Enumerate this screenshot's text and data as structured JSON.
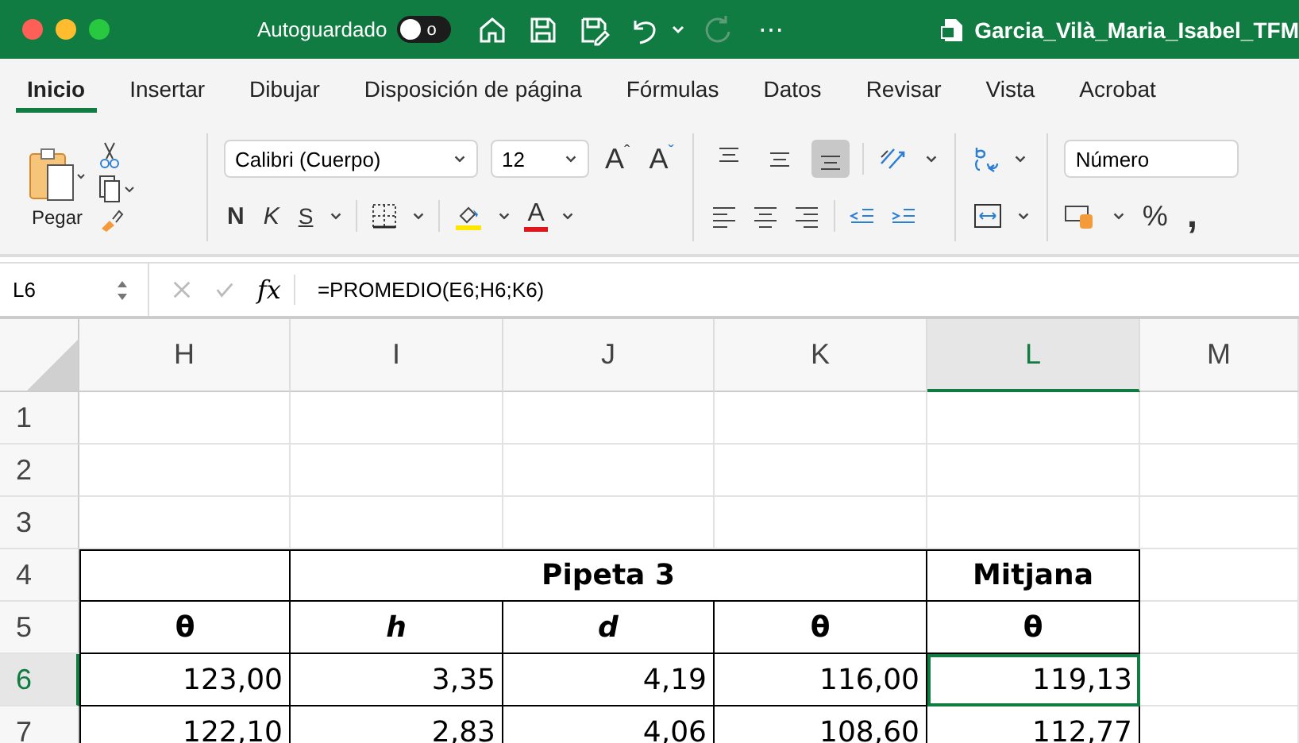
{
  "window": {
    "autosave_label": "Autoguardado",
    "autosave_on": false,
    "autosave_toggle_text": "o",
    "more": "⋯",
    "file_name": "Garcia_Vilà_Maria_Isabel_TFM"
  },
  "tabs": [
    {
      "label": "Inicio",
      "selected": true
    },
    {
      "label": "Insertar",
      "selected": false
    },
    {
      "label": "Dibujar",
      "selected": false
    },
    {
      "label": "Disposición de página",
      "selected": false
    },
    {
      "label": "Fórmulas",
      "selected": false
    },
    {
      "label": "Datos",
      "selected": false
    },
    {
      "label": "Revisar",
      "selected": false
    },
    {
      "label": "Vista",
      "selected": false
    },
    {
      "label": "Acrobat",
      "selected": false
    }
  ],
  "ribbon": {
    "paste_label": "Pegar",
    "font_name": "Calibri (Cuerpo)",
    "font_size": "12",
    "grow": "A",
    "shrink": "A",
    "bold": "N",
    "italic": "K",
    "underline": "S",
    "font_color_letter": "A",
    "number_format": "Número",
    "percent": "%",
    "comma": ",",
    "grow_mark": "ˆ",
    "shrink_mark": "ˇ",
    "vertical_align": [
      {
        "selected": false
      },
      {
        "selected": false
      },
      {
        "selected": true
      }
    ]
  },
  "formula_bar": {
    "name_box": "L6",
    "fx": "fx",
    "formula": "=PROMEDIO(E6;H6;K6)"
  },
  "columns": [
    {
      "label": "H",
      "selected": false
    },
    {
      "label": "I",
      "selected": false
    },
    {
      "label": "J",
      "selected": false
    },
    {
      "label": "K",
      "selected": false
    },
    {
      "label": "L",
      "selected": true
    },
    {
      "label": "M",
      "selected": false
    }
  ],
  "rows": [
    {
      "number": "1",
      "selected": false,
      "bordered": false,
      "cells": {}
    },
    {
      "number": "2",
      "selected": false,
      "bordered": false,
      "cells": {}
    },
    {
      "number": "3",
      "selected": false,
      "bordered": false,
      "cells": {}
    },
    {
      "number": "4",
      "selected": false,
      "bordered": true,
      "cells": {
        "I": {
          "text": "Pipeta 3",
          "kind": "merged-header",
          "selected": false
        },
        "L": {
          "text": "Mitjana",
          "kind": "header",
          "selected": false
        }
      }
    },
    {
      "number": "5",
      "selected": false,
      "bordered": true,
      "cells": {
        "H": {
          "text": "θ",
          "kind": "header",
          "selected": false
        },
        "I": {
          "text": "h",
          "kind": "italic-header",
          "selected": false
        },
        "J": {
          "text": "d",
          "kind": "italic-header",
          "selected": false
        },
        "K": {
          "text": "θ",
          "kind": "header",
          "selected": false
        },
        "L": {
          "text": "θ",
          "kind": "header",
          "selected": false
        }
      }
    },
    {
      "number": "6",
      "selected": true,
      "bordered": true,
      "cells": {
        "H": {
          "text": "123,00",
          "kind": "number",
          "selected": false
        },
        "I": {
          "text": "3,35",
          "kind": "number",
          "selected": false
        },
        "J": {
          "text": "4,19",
          "kind": "number",
          "selected": false
        },
        "K": {
          "text": "116,00",
          "kind": "number",
          "selected": false
        },
        "L": {
          "text": "119,13",
          "kind": "number",
          "selected": true
        }
      }
    },
    {
      "number": "7",
      "selected": false,
      "bordered": true,
      "cells": {
        "H": {
          "text": "122,10",
          "kind": "number",
          "selected": false
        },
        "I": {
          "text": "2,83",
          "kind": "number",
          "selected": false
        },
        "J": {
          "text": "4,06",
          "kind": "number",
          "selected": false
        },
        "K": {
          "text": "108,60",
          "kind": "number",
          "selected": false
        },
        "L": {
          "text": "112,77",
          "kind": "number",
          "selected": false
        }
      }
    }
  ]
}
